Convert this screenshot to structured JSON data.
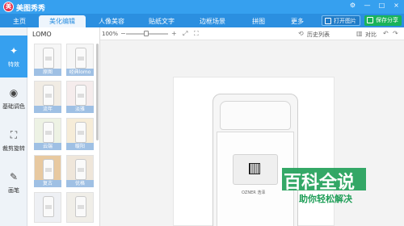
{
  "app": {
    "logo_char": "美",
    "title": "美图秀秀"
  },
  "window_controls": [
    "⚙",
    "—",
    "□",
    "×"
  ],
  "nav": {
    "tabs": [
      "主页",
      "美化编辑",
      "人像美容",
      "贴纸文字",
      "边框场景",
      "拼图",
      "更多"
    ],
    "active_index": 1,
    "open_label": "打开图片",
    "save_label": "保存分享"
  },
  "tools": [
    {
      "label": "特效",
      "icon": "magic-wand-icon",
      "glyph": "✦",
      "active": true
    },
    {
      "label": "基础调色",
      "icon": "palette-icon",
      "glyph": "◉",
      "active": false
    },
    {
      "label": "裁剪旋转",
      "icon": "crop-icon",
      "glyph": "⛶",
      "active": false
    },
    {
      "label": "画笔",
      "icon": "brush-icon",
      "glyph": "✎",
      "active": false
    }
  ],
  "panel": {
    "category": "LOMO",
    "effects": [
      "原图",
      "经典lomo",
      "流年",
      "淡雅",
      "云端",
      "暖阳",
      "复古",
      "优格",
      "",
      ""
    ]
  },
  "toolbar": {
    "zoom": "100%",
    "history": "历史列表",
    "compare": "对比"
  },
  "photo": {
    "brand_text": "OZNER 浩泽"
  },
  "watermark": {
    "main": "百科全说",
    "sub": "助你轻松解决"
  },
  "colors": {
    "titlebar": "#36a0ef",
    "navbar": "#2b8fe0",
    "save": "#19b35a",
    "active_tool": "#36a0ef"
  }
}
